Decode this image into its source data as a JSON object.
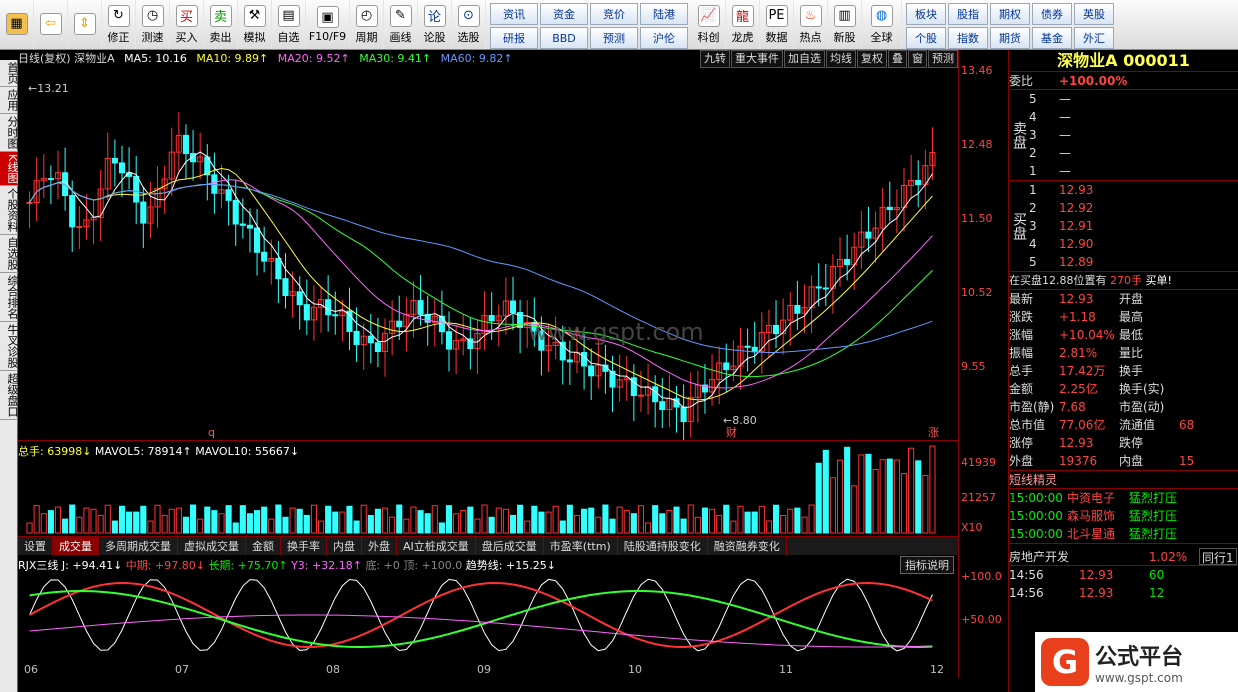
{
  "toolbar": {
    "buttons": [
      "修正",
      "测速",
      "买入",
      "卖出",
      "模拟",
      "自选",
      "F10/F9",
      "周期",
      "画线",
      "论股",
      "选股",
      "科创",
      "龙虎",
      "数据",
      "热点",
      "新股",
      "全球"
    ],
    "quick": [
      "资讯",
      "资金",
      "竞价",
      "陆港",
      "研报",
      "BBD",
      "预测",
      "沪伦"
    ],
    "right": [
      "板块",
      "股指",
      "期权",
      "债券",
      "英股",
      "个股",
      "指数",
      "期货",
      "基金",
      "外汇"
    ]
  },
  "sidetabs": [
    "首页",
    "应用",
    "分时图",
    "K线图",
    "个股资料",
    "自选股",
    "综合排名",
    "牛叉诊股",
    "超级盘口"
  ],
  "header": {
    "title": "日线(复权) 深物业A",
    "ma5": "MA5: 10.16",
    "ma10": "MA10: 9.89↑",
    "ma20": "MA20: 9.52↑",
    "ma30": "MA30: 9.41↑",
    "ma60": "MA60: 9.82↑",
    "buttons": [
      "九转",
      "重大事件",
      "加自选",
      "均线",
      "复权",
      "叠",
      "窗",
      "预测"
    ]
  },
  "chart_data": {
    "type": "candlestick",
    "ylim": [
      8.8,
      13.46
    ],
    "price_ticks": [
      "13.46",
      "12.48",
      "11.50",
      "10.52",
      "9.55"
    ],
    "annotations": [
      "13.21",
      "8.80",
      "财",
      "q",
      "涨"
    ],
    "x_ticks": [
      "06",
      "07",
      "08",
      "09",
      "10",
      "11",
      "12"
    ],
    "volume": {
      "label": "总手: 63998↓",
      "mavol5": "MAVOL5: 78914↑",
      "mavol10": "MAVOL10: 55667↓",
      "ticks": [
        "41939",
        "21257",
        "X10"
      ]
    },
    "indicator": {
      "label": "RJX三线 J: +94.41↓",
      "mid": "中期: +97.80↓",
      "long": "长期: +75.70↑",
      "y3": "Y3: +32.18↑",
      "bottom": "底: +0",
      "top": "顶: +100.0",
      "trend": "趋势线: +15.25↓",
      "ticks": [
        "+100.0",
        "+50.00"
      ]
    }
  },
  "bottomtabs": [
    "设置",
    "成交量",
    "多周期成交量",
    "虚拟成交量",
    "金额",
    "换手率",
    "内盘",
    "外盘",
    "AI立桩成交量",
    "盘后成交量",
    "市盈率(ttm)",
    "陆股通持股变化",
    "融资融券变化"
  ],
  "ind_btn": "指标说明",
  "right": {
    "title": "深物业A 000011",
    "weibi": "委比",
    "weibi_v": "+100.00%",
    "sell_label": "卖盘",
    "sells": [
      [
        "5",
        "—"
      ],
      [
        "4",
        "—"
      ],
      [
        "3",
        "—"
      ],
      [
        "2",
        "—"
      ],
      [
        "1",
        "—"
      ]
    ],
    "buy_label": "买盘",
    "buys": [
      [
        "1",
        "12.93"
      ],
      [
        "2",
        "12.92"
      ],
      [
        "3",
        "12.91"
      ],
      [
        "4",
        "12.90"
      ],
      [
        "5",
        "12.89"
      ]
    ],
    "note": "在买盘12.88位置有",
    "note_v": "270手",
    "note2": "买单!",
    "stats": [
      [
        "最新",
        "12.93",
        "开盘",
        ""
      ],
      [
        "涨跌",
        "+1.18",
        "最高",
        ""
      ],
      [
        "涨幅",
        "+10.04%",
        "最低",
        ""
      ],
      [
        "振幅",
        "2.81%",
        "量比",
        ""
      ],
      [
        "总手",
        "17.42万",
        "换手",
        ""
      ],
      [
        "金额",
        "2.25亿",
        "换手(实)",
        ""
      ],
      [
        "市盈(静)",
        "7.68",
        "市盈(动)",
        ""
      ],
      [
        "总市值",
        "77.06亿",
        "流通值",
        "68"
      ],
      [
        "涨停",
        "12.93",
        "跌停",
        ""
      ],
      [
        "外盘",
        "19376",
        "内盘",
        "15"
      ]
    ],
    "sprite_title": "短线精灵",
    "sprites": [
      [
        "15:00:00",
        "中资电子",
        "猛烈打压"
      ],
      [
        "15:00:00",
        "森马服饰",
        "猛烈打压"
      ],
      [
        "15:00:00",
        "北斗星通",
        "猛烈打压"
      ]
    ],
    "sector": "房地产开发",
    "sector_v": "1.02%",
    "sector_btn": "同行1",
    "ticks": [
      [
        "14:56",
        "12.93",
        "60"
      ],
      [
        "14:56",
        "12.93",
        "12"
      ]
    ]
  },
  "watermark": "www.gspt.com",
  "logo": "公式平台",
  "logo_url": "www.gspt.com"
}
